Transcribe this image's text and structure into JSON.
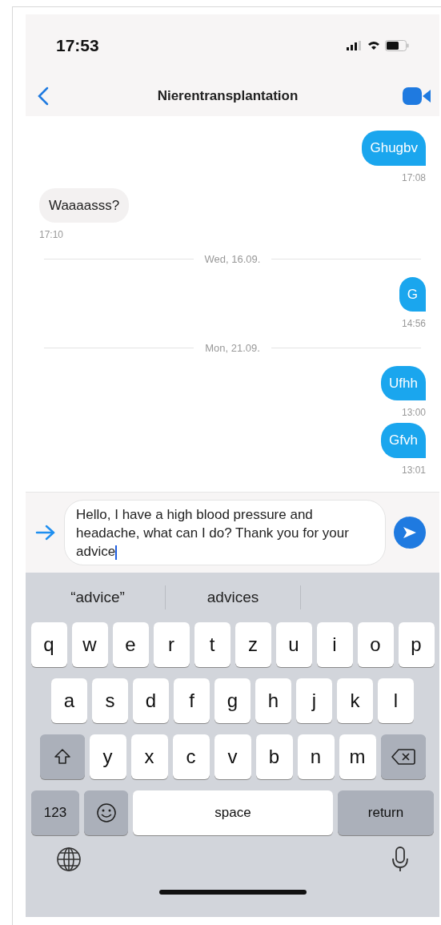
{
  "status_bar": {
    "time": "17:53"
  },
  "header": {
    "title": "Nierentransplantation"
  },
  "thread": [
    {
      "kind": "message",
      "outgoing": true,
      "text": "Ghugbv",
      "time": "17:08"
    },
    {
      "kind": "message",
      "outgoing": false,
      "text": "Waaaasss?",
      "time": "17:10"
    },
    {
      "kind": "divider",
      "text": "Wed, 16.09."
    },
    {
      "kind": "message",
      "outgoing": true,
      "text": "G",
      "time": "14:56"
    },
    {
      "kind": "divider",
      "text": "Mon, 21.09."
    },
    {
      "kind": "message",
      "outgoing": true,
      "text": "Ufhh",
      "time": "13:00"
    },
    {
      "kind": "message",
      "outgoing": true,
      "text": "Gfvh",
      "time": "13:01"
    }
  ],
  "composer": {
    "value": "Hello, I have a high blood pressure and headache, what can I do? Thank you for your advice"
  },
  "keyboard": {
    "suggestions": [
      "“advice”",
      "advices"
    ],
    "rows": [
      {
        "keys": [
          {
            "kind": "letter",
            "label": "q"
          },
          {
            "kind": "letter",
            "label": "w"
          },
          {
            "kind": "letter",
            "label": "e"
          },
          {
            "kind": "letter",
            "label": "r"
          },
          {
            "kind": "letter",
            "label": "t"
          },
          {
            "kind": "letter",
            "label": "z"
          },
          {
            "kind": "letter",
            "label": "u"
          },
          {
            "kind": "letter",
            "label": "i"
          },
          {
            "kind": "letter",
            "label": "o"
          },
          {
            "kind": "letter",
            "label": "p"
          }
        ]
      },
      {
        "keys": [
          {
            "kind": "letter",
            "label": "a"
          },
          {
            "kind": "letter",
            "label": "s"
          },
          {
            "kind": "letter",
            "label": "d"
          },
          {
            "kind": "letter",
            "label": "f"
          },
          {
            "kind": "letter",
            "label": "g"
          },
          {
            "kind": "letter",
            "label": "h"
          },
          {
            "kind": "letter",
            "label": "j"
          },
          {
            "kind": "letter",
            "label": "k"
          },
          {
            "kind": "letter",
            "label": "l"
          }
        ]
      },
      {
        "keys": [
          {
            "kind": "shift"
          },
          {
            "kind": "letter",
            "label": "y"
          },
          {
            "kind": "letter",
            "label": "x"
          },
          {
            "kind": "letter",
            "label": "c"
          },
          {
            "kind": "letter",
            "label": "v"
          },
          {
            "kind": "letter",
            "label": "b"
          },
          {
            "kind": "letter",
            "label": "n"
          },
          {
            "kind": "letter",
            "label": "m"
          },
          {
            "kind": "delete"
          }
        ]
      },
      {
        "keys": [
          {
            "kind": "numbers",
            "label": "123"
          },
          {
            "kind": "emoji"
          },
          {
            "kind": "space",
            "label": "space"
          },
          {
            "kind": "return",
            "label": "return"
          }
        ]
      }
    ]
  }
}
